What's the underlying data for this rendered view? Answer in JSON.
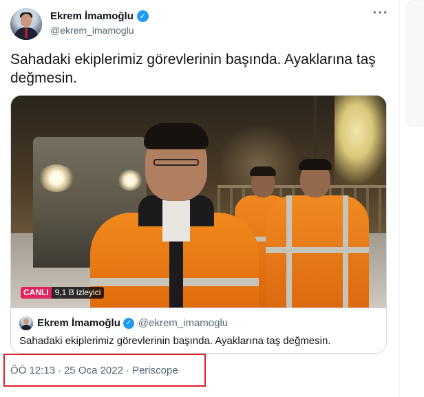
{
  "author": {
    "name": "Ekrem İmamoğlu",
    "handle": "@ekrem_imamoglu",
    "verified_icon": "verified-badge-icon"
  },
  "menu": {
    "more_label": "···"
  },
  "tweet": {
    "text": "Sahadaki ekiplerimiz görevlerinin başında. Ayaklarına taş değmesin."
  },
  "video": {
    "live_label": "CANLI",
    "viewers": "9,1 B izleyici"
  },
  "quoted": {
    "name": "Ekrem İmamoğlu",
    "handle": "@ekrem_imamoglu",
    "text": "Sahadaki ekiplerimiz görevlerinin başında. Ayaklarına taş değmesin."
  },
  "meta": {
    "time": "ÖÖ 12:13",
    "separator": "·",
    "date": "25 Oca 2022",
    "source": "Periscope"
  },
  "colors": {
    "verified": "#1d9bf0",
    "live": "#e0245e",
    "highlight_box": "#e11d25",
    "secondary_text": "#536471"
  }
}
